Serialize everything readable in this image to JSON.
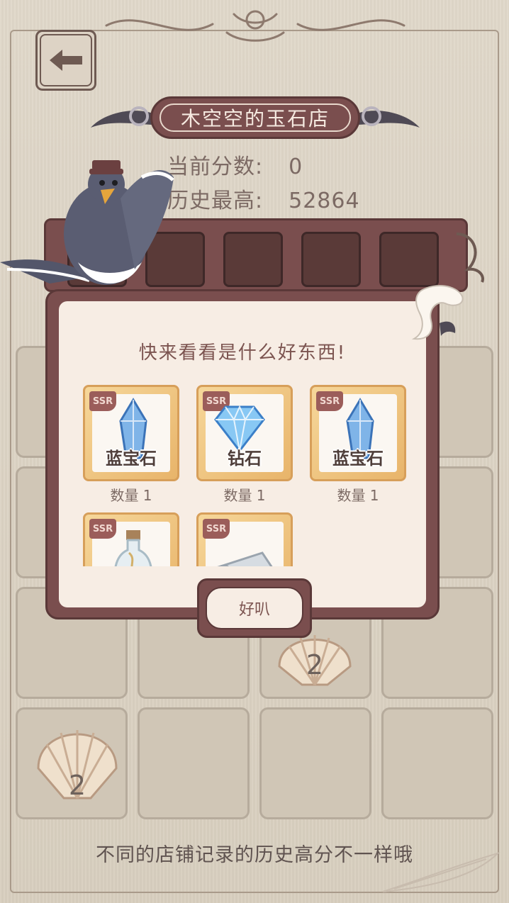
{
  "shop": {
    "title": "木空空的玉石店"
  },
  "score": {
    "current_label": "当前分数:",
    "current_value": "0",
    "best_label": "历史最高:",
    "best_value": "52864"
  },
  "board": {
    "shells": [
      {
        "value": "2"
      },
      {
        "value": "2"
      }
    ]
  },
  "dialog": {
    "title": "快来看看是什么好东西!",
    "items": [
      {
        "rarity": "SSR",
        "name": "蓝宝石",
        "count": "数量 1",
        "icon": "crystal-icon"
      },
      {
        "rarity": "SSR",
        "name": "钻石",
        "count": "数量 1",
        "icon": "diamond-icon"
      },
      {
        "rarity": "SSR",
        "name": "蓝宝石",
        "count": "数量 1",
        "icon": "crystal-icon"
      },
      {
        "rarity": "SSR",
        "name": "",
        "count": "",
        "icon": "bottle-icon"
      },
      {
        "rarity": "SSR",
        "name": "",
        "count": "",
        "icon": "cloth-roll-icon"
      }
    ],
    "ok_label": "好叭"
  },
  "tip": "不同的店铺记录的历史高分不一样哦",
  "colors": {
    "panel": "#7a4e4e",
    "panel_border": "#5a3838",
    "dialog_bg": "#f7ede4",
    "card_gold": "#e8b46a",
    "text_brown": "#7c6a64"
  }
}
